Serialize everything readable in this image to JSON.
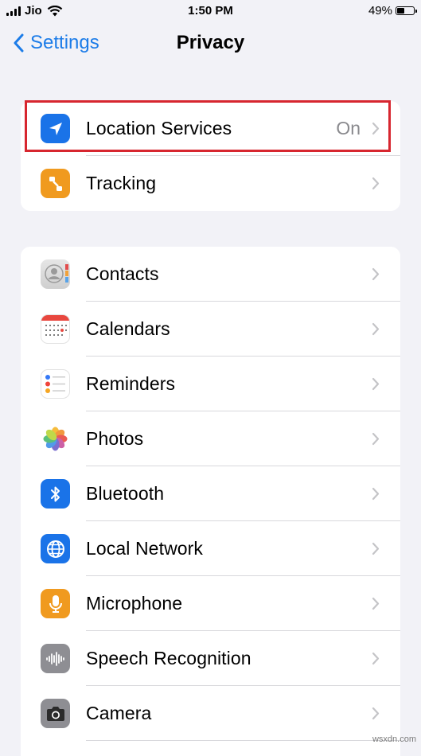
{
  "status_bar": {
    "carrier": "Jio",
    "time": "1:50 PM",
    "battery_percent": "49%",
    "battery_level": 0.49
  },
  "nav": {
    "back_label": "Settings",
    "title": "Privacy"
  },
  "group1": [
    {
      "label": "Location Services",
      "value": "On",
      "icon": "location-arrow-icon",
      "color": "#1a73e8"
    },
    {
      "label": "Tracking",
      "value": "",
      "icon": "tracking-icon",
      "color": "#f09a1f"
    }
  ],
  "group2": [
    {
      "label": "Contacts",
      "icon": "contacts-icon"
    },
    {
      "label": "Calendars",
      "icon": "calendar-icon"
    },
    {
      "label": "Reminders",
      "icon": "reminders-icon"
    },
    {
      "label": "Photos",
      "icon": "photos-icon"
    },
    {
      "label": "Bluetooth",
      "icon": "bluetooth-icon",
      "color": "#1a73e8"
    },
    {
      "label": "Local Network",
      "icon": "globe-icon",
      "color": "#1a73e8"
    },
    {
      "label": "Microphone",
      "icon": "microphone-icon",
      "color": "#f09a1f"
    },
    {
      "label": "Speech Recognition",
      "icon": "waveform-icon",
      "color": "#8e8e93"
    },
    {
      "label": "Camera",
      "icon": "camera-icon",
      "color": "#8e8e93"
    }
  ],
  "watermark": "wsxdn.com"
}
